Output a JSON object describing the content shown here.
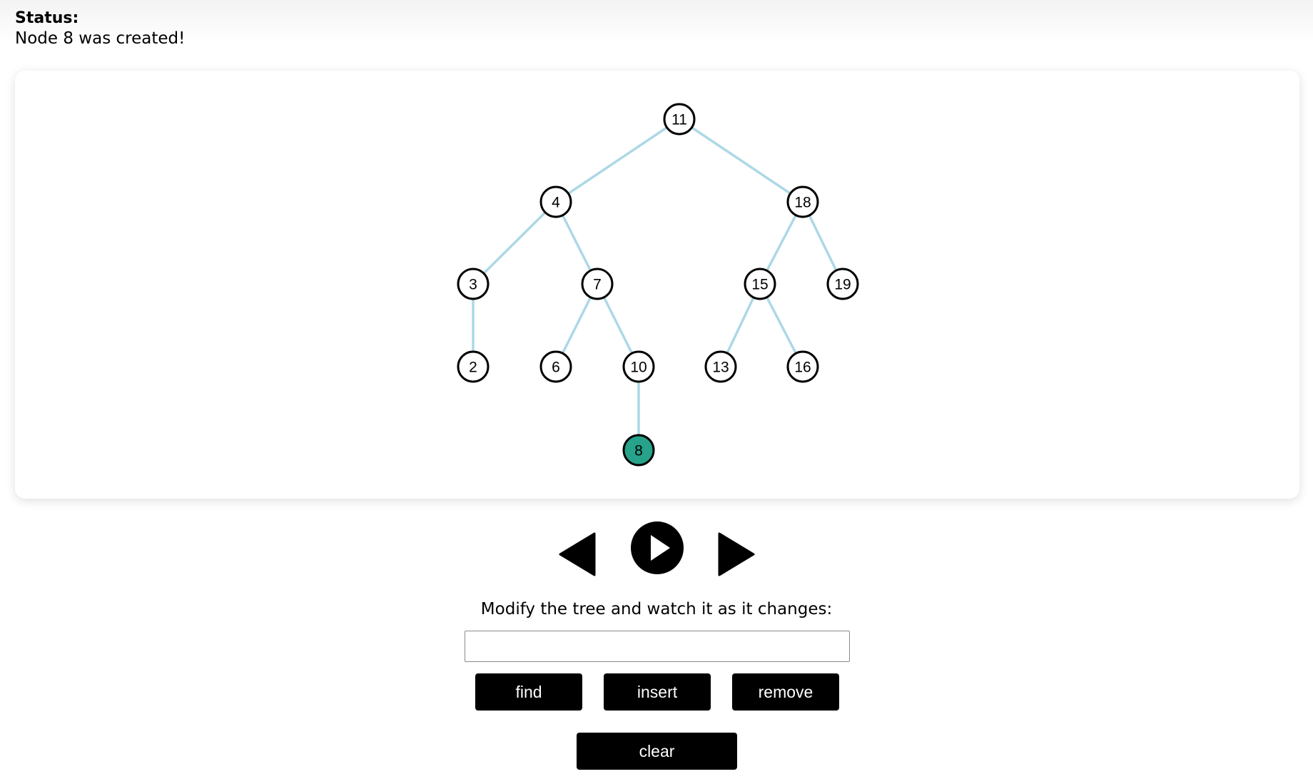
{
  "status": {
    "title": "Status:",
    "message": "Node 8 was created!"
  },
  "tree": {
    "nodes": [
      {
        "value": "11",
        "highlighted": false
      },
      {
        "value": "4",
        "highlighted": false
      },
      {
        "value": "18",
        "highlighted": false
      },
      {
        "value": "3",
        "highlighted": false
      },
      {
        "value": "7",
        "highlighted": false
      },
      {
        "value": "15",
        "highlighted": false
      },
      {
        "value": "19",
        "highlighted": false
      },
      {
        "value": "2",
        "highlighted": false
      },
      {
        "value": "6",
        "highlighted": false
      },
      {
        "value": "10",
        "highlighted": false
      },
      {
        "value": "13",
        "highlighted": false
      },
      {
        "value": "16",
        "highlighted": false
      },
      {
        "value": "8",
        "highlighted": true
      }
    ],
    "edges": [
      [
        "11",
        "4"
      ],
      [
        "11",
        "18"
      ],
      [
        "4",
        "3"
      ],
      [
        "4",
        "7"
      ],
      [
        "18",
        "15"
      ],
      [
        "18",
        "19"
      ],
      [
        "3",
        "2"
      ],
      [
        "7",
        "6"
      ],
      [
        "7",
        "10"
      ],
      [
        "15",
        "13"
      ],
      [
        "15",
        "16"
      ],
      [
        "10",
        "8"
      ]
    ],
    "colors": {
      "edge": "#add8e6",
      "highlight": "#26a38a"
    }
  },
  "playback": {
    "prev_icon": "triangle-left-icon",
    "play_icon": "play-circle-icon",
    "next_icon": "triangle-right-icon"
  },
  "modify": {
    "label": "Modify the tree and watch it as it changes:",
    "input_value": "",
    "input_placeholder": ""
  },
  "buttons": {
    "find": "find",
    "insert": "insert",
    "remove": "remove",
    "clear": "clear"
  }
}
